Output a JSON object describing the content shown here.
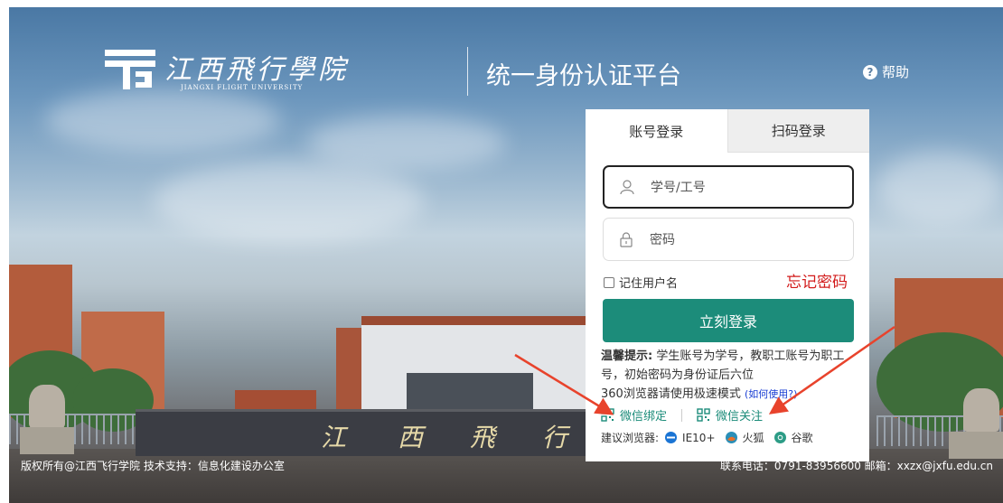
{
  "header": {
    "logo_cn": "江西飛行學院",
    "logo_en": "JIANGXI FLIGHT UNIVERSITY",
    "platform_title": "统一身份认证平台",
    "help_label": "帮助"
  },
  "campus_sign": [
    "江",
    "西",
    "飛",
    "行"
  ],
  "login": {
    "tabs": [
      {
        "label": "账号登录",
        "active": true
      },
      {
        "label": "扫码登录",
        "active": false
      }
    ],
    "username_placeholder": "学号/工号",
    "password_placeholder": "密码",
    "remember_label": "记住用户名",
    "forgot_label": "忘记密码",
    "submit_label": "立刻登录",
    "tip_title": "温馨提示:",
    "tip_text": "学生账号为学号，教职工账号为职工号，初始密码为身份证后六位",
    "browser_mode_text": "360浏览器请使用极速模式",
    "how_to_use": "(如何使用?)",
    "wechat_bind": "微信绑定",
    "wechat_follow": "微信关注",
    "browsers_label": "建议浏览器:",
    "browsers": [
      "IE10+",
      "火狐",
      "谷歌"
    ]
  },
  "footer": {
    "copyright": "版权所有@江西飞行学院 技术支持：信息化建设办公室",
    "contact": "联系电话：0791-83956600 邮箱：xxzx@jxfu.edu.cn"
  },
  "colors": {
    "primary": "#1c8c7a",
    "forgot": "#d21b1b",
    "arrow": "#e8432c",
    "link": "#1a3fd4"
  }
}
